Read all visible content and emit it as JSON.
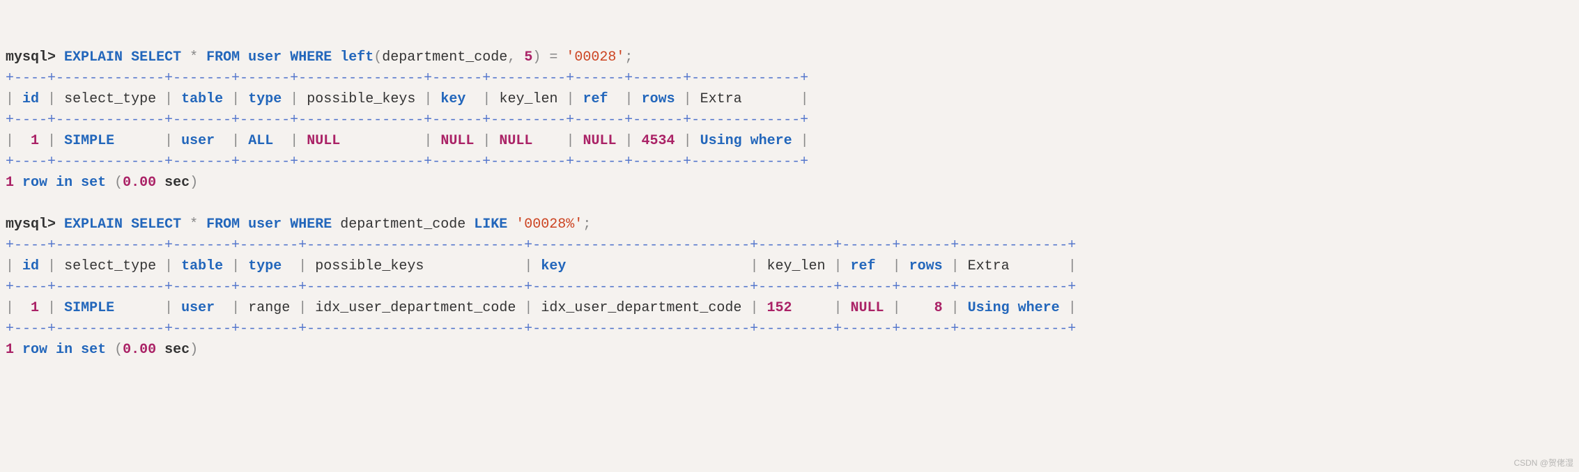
{
  "query1": {
    "prompt": "mysql>",
    "cmd": {
      "explain": "EXPLAIN",
      "select": "SELECT",
      "star": "*",
      "from": "FROM",
      "table": "user",
      "where": "WHERE",
      "func": "left",
      "lparen": "(",
      "col": "department_code",
      "comma": ",",
      "arg": "5",
      "rparen": ")",
      "eq": "=",
      "lit": "'00028'",
      "semi": ";"
    },
    "border": "+----+-------------+-------+------+---------------+------+---------+------+------+-------------+",
    "header": {
      "id": "id",
      "select_type": "select_type",
      "table": "table",
      "type": "type",
      "possible_keys": "possible_keys",
      "key": "key",
      "key_len": "key_len",
      "ref": "ref",
      "rows": "rows",
      "extra": "Extra"
    },
    "row": {
      "id": "1",
      "select_type": "SIMPLE",
      "table": "user",
      "type": "ALL",
      "possible_keys": "NULL",
      "key": "NULL",
      "key_len": "NULL",
      "ref": "NULL",
      "rows": "4534",
      "extra": "Using where"
    },
    "footer": {
      "count": "1",
      "row_word": "row",
      "in": "in",
      "set": "set",
      "lp": "(",
      "time": "0.00",
      "sec": "sec",
      "rp": ")"
    }
  },
  "query2": {
    "prompt": "mysql>",
    "cmd": {
      "explain": "EXPLAIN",
      "select": "SELECT",
      "star": "*",
      "from": "FROM",
      "table": "user",
      "where": "WHERE",
      "col": "department_code",
      "like": "LIKE",
      "lit": "'00028%'",
      "semi": ";"
    },
    "border": "+----+-------------+-------+-------+--------------------------+--------------------------+---------+------+------+-------------+",
    "header": {
      "id": "id",
      "select_type": "select_type",
      "table": "table",
      "type": "type",
      "possible_keys": "possible_keys",
      "key": "key",
      "key_len": "key_len",
      "ref": "ref",
      "rows": "rows",
      "extra": "Extra"
    },
    "row": {
      "id": "1",
      "select_type": "SIMPLE",
      "table": "user",
      "type": "range",
      "possible_keys": "idx_user_department_code",
      "key": "idx_user_department_code",
      "key_len": "152",
      "ref": "NULL",
      "rows": "8",
      "extra": "Using where"
    },
    "footer": {
      "count": "1",
      "row_word": "row",
      "in": "in",
      "set": "set",
      "lp": "(",
      "time": "0.00",
      "sec": "sec",
      "rp": ")"
    }
  },
  "watermark": "CSDN @贺佬湿"
}
